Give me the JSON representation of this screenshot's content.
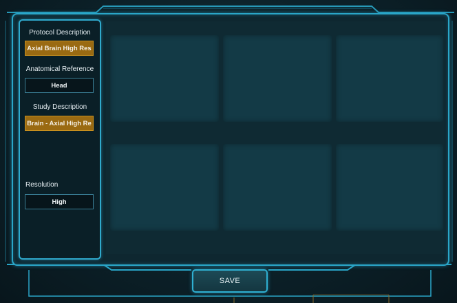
{
  "sidebar": {
    "protocol_description": {
      "label": "Protocol Description",
      "value": "Axial Brain High Res"
    },
    "anatomical_reference": {
      "label": "Anatomical Reference",
      "value": "Head"
    },
    "study_description": {
      "label": "Study Description",
      "value": "Brain - Axial High Re"
    },
    "resolution": {
      "label": "Resolution",
      "value": "High"
    }
  },
  "viewports": {
    "count": 6
  },
  "footer": {
    "save_label": "SAVE"
  },
  "colors": {
    "accent": "#2aa6c8",
    "selected_field": "#9a6a12",
    "background": "#0b1c24"
  }
}
